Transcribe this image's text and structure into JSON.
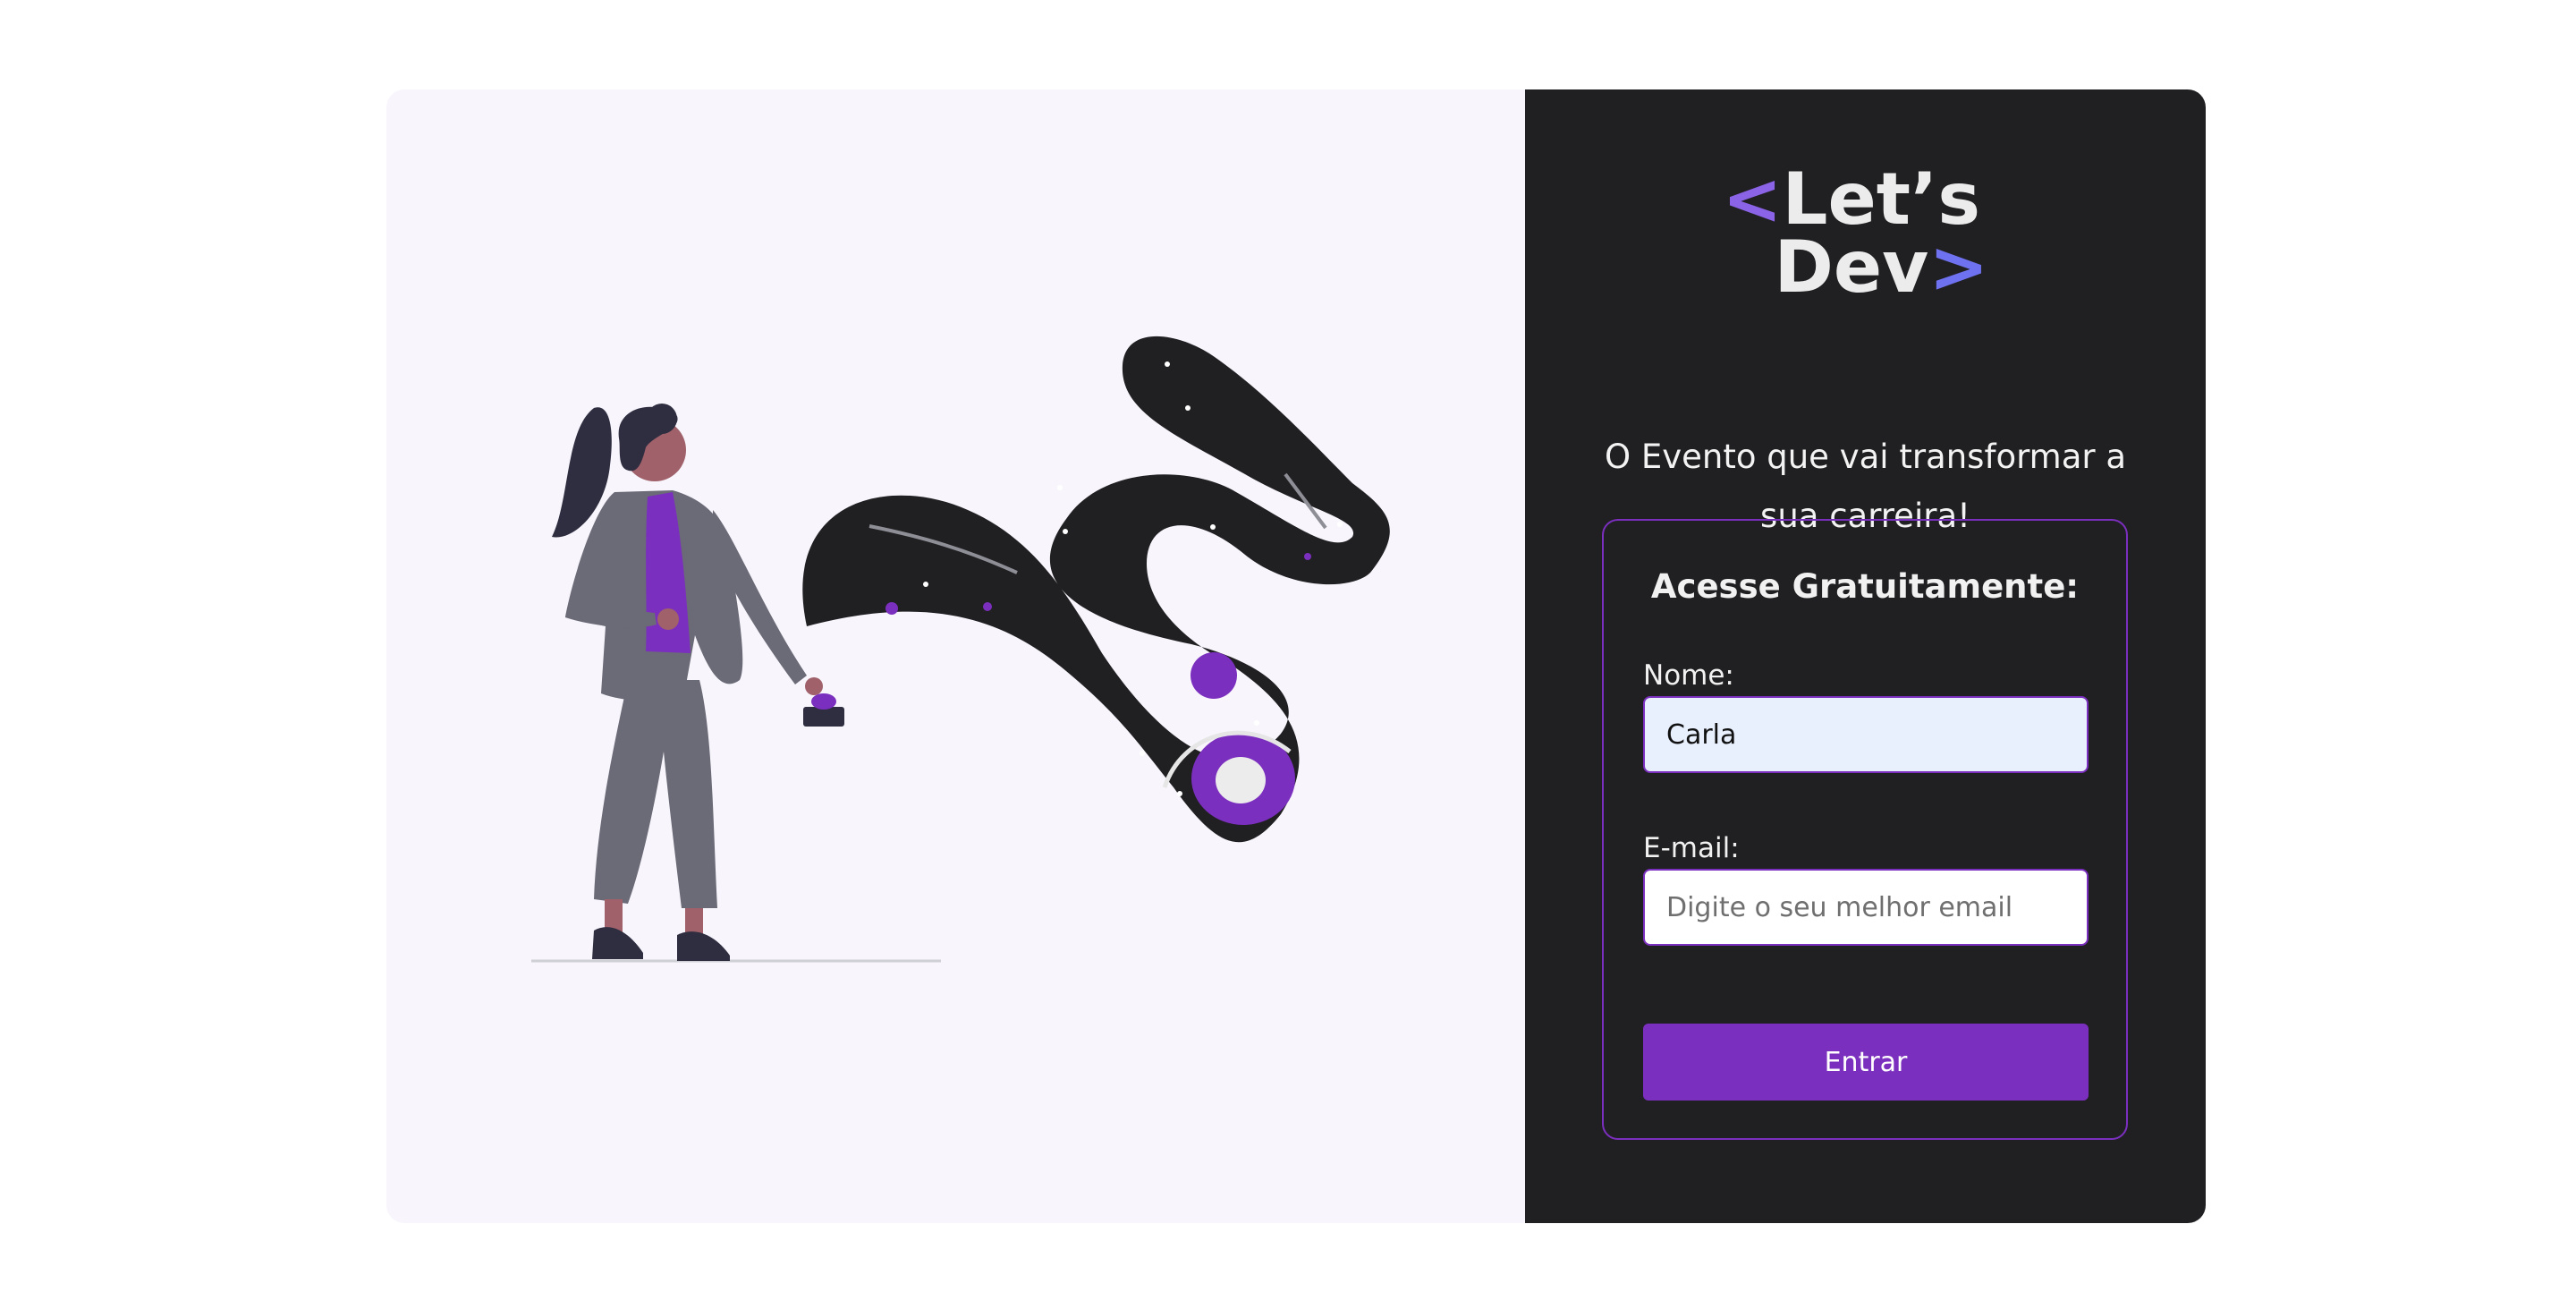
{
  "logo": {
    "lt": "<",
    "line1": "Let’s",
    "line2": "Dev",
    "gt": ">"
  },
  "tagline": "O Evento que vai transformar a sua carreira!",
  "form": {
    "title": "Acesse Gratuitamente:",
    "name_label": "Nome:",
    "name_value": "Carla",
    "email_label": "E-mail:",
    "email_placeholder": "Digite o seu melhor email",
    "submit_label": "Entrar"
  },
  "colors": {
    "accent": "#7b2fbe",
    "panel_dark": "#201f21",
    "panel_light": "#f8f6fc",
    "autofill": "#e8f0fe"
  },
  "illustration": {
    "name": "woman-pressing-button-space-illustration"
  }
}
